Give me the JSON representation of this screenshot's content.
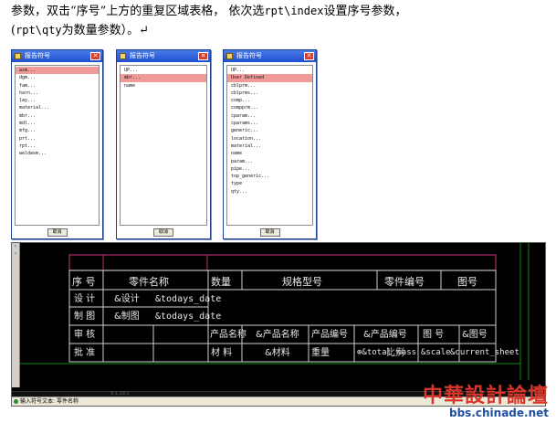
{
  "intro": {
    "line1_a": "参数，双击“序号”上方的重复区域表格，  依次选",
    "line1_code": "rpt\\index",
    "line1_b": "设置序号参数，",
    "line2_a": "(",
    "line2_code": "rpt\\qty",
    "line2_b": "为数量参数）。↵"
  },
  "dialogs": [
    {
      "title": "报告符号",
      "cancel": "取消",
      "items": [
        "asm...",
        "dgm...",
        "fam...",
        "harn...",
        "lay...",
        "material...",
        "mbr...",
        "mdl...",
        "mfg...",
        "prt...",
        "rpt...",
        "weldasm..."
      ],
      "selected": 0
    },
    {
      "title": "报告符号",
      "cancel": "取消",
      "items": [
        "UP...",
        "mbr...",
        "name"
      ],
      "selected": 1
    },
    {
      "title": "报告符号",
      "cancel": "取消",
      "items": [
        "UP...",
        "User Defined",
        "cblprm...",
        "cblprms...",
        "comp...",
        "compprm...",
        "cparam...",
        "cparams...",
        "generic...",
        "location...",
        "material...",
        "name",
        "param...",
        "pipe...",
        "top_generic...",
        "type",
        "qty..."
      ],
      "selected": 1
    }
  ],
  "cad": {
    "leftbar_icons": [
      "›",
      "›"
    ],
    "status_text": "9.1.19.1",
    "cmd_label": "输入符号文本:",
    "cmd_value": "零件名称",
    "table": {
      "header": [
        "序 号",
        "零件名称",
        "数量",
        "规格型号",
        "零件编号",
        "图号"
      ],
      "rows": [
        [
          "设 计",
          "&设计",
          "&todays_date"
        ],
        [
          "制 图",
          "&制图",
          "&todays_date"
        ],
        [
          "审 核",
          "产品名称",
          "&产品名称",
          "产品编号",
          "&产品编号",
          "图 号",
          "&图号"
        ],
        [
          "批 准",
          "材 料",
          "&材料",
          "重量",
          "&total_mass",
          "比例",
          "&scale",
          "&current_sheet"
        ]
      ]
    }
  },
  "watermark": {
    "top": "中華設計論壇",
    "bottom": "bbs.chinade.net"
  }
}
